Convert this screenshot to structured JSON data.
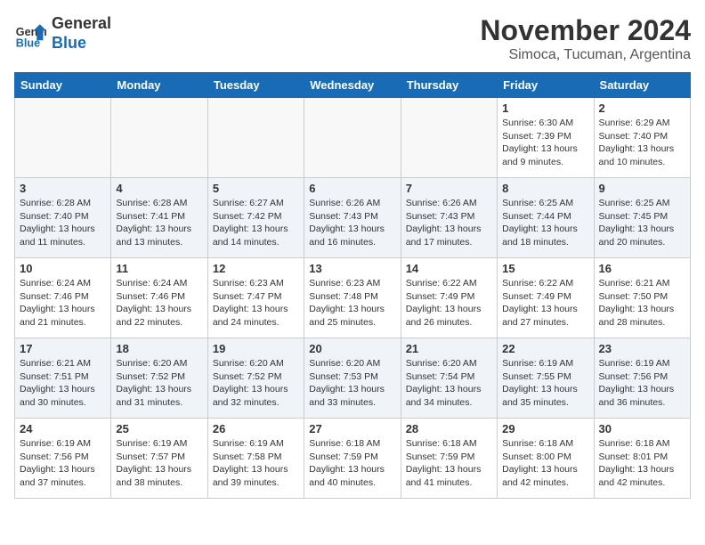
{
  "logo": {
    "line1": "General",
    "line2": "Blue"
  },
  "title": "November 2024",
  "subtitle": "Simoca, Tucuman, Argentina",
  "days_of_week": [
    "Sunday",
    "Monday",
    "Tuesday",
    "Wednesday",
    "Thursday",
    "Friday",
    "Saturday"
  ],
  "weeks": [
    [
      {
        "day": "",
        "info": ""
      },
      {
        "day": "",
        "info": ""
      },
      {
        "day": "",
        "info": ""
      },
      {
        "day": "",
        "info": ""
      },
      {
        "day": "",
        "info": ""
      },
      {
        "day": "1",
        "info": "Sunrise: 6:30 AM\nSunset: 7:39 PM\nDaylight: 13 hours\nand 9 minutes."
      },
      {
        "day": "2",
        "info": "Sunrise: 6:29 AM\nSunset: 7:40 PM\nDaylight: 13 hours\nand 10 minutes."
      }
    ],
    [
      {
        "day": "3",
        "info": "Sunrise: 6:28 AM\nSunset: 7:40 PM\nDaylight: 13 hours\nand 11 minutes."
      },
      {
        "day": "4",
        "info": "Sunrise: 6:28 AM\nSunset: 7:41 PM\nDaylight: 13 hours\nand 13 minutes."
      },
      {
        "day": "5",
        "info": "Sunrise: 6:27 AM\nSunset: 7:42 PM\nDaylight: 13 hours\nand 14 minutes."
      },
      {
        "day": "6",
        "info": "Sunrise: 6:26 AM\nSunset: 7:43 PM\nDaylight: 13 hours\nand 16 minutes."
      },
      {
        "day": "7",
        "info": "Sunrise: 6:26 AM\nSunset: 7:43 PM\nDaylight: 13 hours\nand 17 minutes."
      },
      {
        "day": "8",
        "info": "Sunrise: 6:25 AM\nSunset: 7:44 PM\nDaylight: 13 hours\nand 18 minutes."
      },
      {
        "day": "9",
        "info": "Sunrise: 6:25 AM\nSunset: 7:45 PM\nDaylight: 13 hours\nand 20 minutes."
      }
    ],
    [
      {
        "day": "10",
        "info": "Sunrise: 6:24 AM\nSunset: 7:46 PM\nDaylight: 13 hours\nand 21 minutes."
      },
      {
        "day": "11",
        "info": "Sunrise: 6:24 AM\nSunset: 7:46 PM\nDaylight: 13 hours\nand 22 minutes."
      },
      {
        "day": "12",
        "info": "Sunrise: 6:23 AM\nSunset: 7:47 PM\nDaylight: 13 hours\nand 24 minutes."
      },
      {
        "day": "13",
        "info": "Sunrise: 6:23 AM\nSunset: 7:48 PM\nDaylight: 13 hours\nand 25 minutes."
      },
      {
        "day": "14",
        "info": "Sunrise: 6:22 AM\nSunset: 7:49 PM\nDaylight: 13 hours\nand 26 minutes."
      },
      {
        "day": "15",
        "info": "Sunrise: 6:22 AM\nSunset: 7:49 PM\nDaylight: 13 hours\nand 27 minutes."
      },
      {
        "day": "16",
        "info": "Sunrise: 6:21 AM\nSunset: 7:50 PM\nDaylight: 13 hours\nand 28 minutes."
      }
    ],
    [
      {
        "day": "17",
        "info": "Sunrise: 6:21 AM\nSunset: 7:51 PM\nDaylight: 13 hours\nand 30 minutes."
      },
      {
        "day": "18",
        "info": "Sunrise: 6:20 AM\nSunset: 7:52 PM\nDaylight: 13 hours\nand 31 minutes."
      },
      {
        "day": "19",
        "info": "Sunrise: 6:20 AM\nSunset: 7:52 PM\nDaylight: 13 hours\nand 32 minutes."
      },
      {
        "day": "20",
        "info": "Sunrise: 6:20 AM\nSunset: 7:53 PM\nDaylight: 13 hours\nand 33 minutes."
      },
      {
        "day": "21",
        "info": "Sunrise: 6:20 AM\nSunset: 7:54 PM\nDaylight: 13 hours\nand 34 minutes."
      },
      {
        "day": "22",
        "info": "Sunrise: 6:19 AM\nSunset: 7:55 PM\nDaylight: 13 hours\nand 35 minutes."
      },
      {
        "day": "23",
        "info": "Sunrise: 6:19 AM\nSunset: 7:56 PM\nDaylight: 13 hours\nand 36 minutes."
      }
    ],
    [
      {
        "day": "24",
        "info": "Sunrise: 6:19 AM\nSunset: 7:56 PM\nDaylight: 13 hours\nand 37 minutes."
      },
      {
        "day": "25",
        "info": "Sunrise: 6:19 AM\nSunset: 7:57 PM\nDaylight: 13 hours\nand 38 minutes."
      },
      {
        "day": "26",
        "info": "Sunrise: 6:19 AM\nSunset: 7:58 PM\nDaylight: 13 hours\nand 39 minutes."
      },
      {
        "day": "27",
        "info": "Sunrise: 6:18 AM\nSunset: 7:59 PM\nDaylight: 13 hours\nand 40 minutes."
      },
      {
        "day": "28",
        "info": "Sunrise: 6:18 AM\nSunset: 7:59 PM\nDaylight: 13 hours\nand 41 minutes."
      },
      {
        "day": "29",
        "info": "Sunrise: 6:18 AM\nSunset: 8:00 PM\nDaylight: 13 hours\nand 42 minutes."
      },
      {
        "day": "30",
        "info": "Sunrise: 6:18 AM\nSunset: 8:01 PM\nDaylight: 13 hours\nand 42 minutes."
      }
    ]
  ]
}
